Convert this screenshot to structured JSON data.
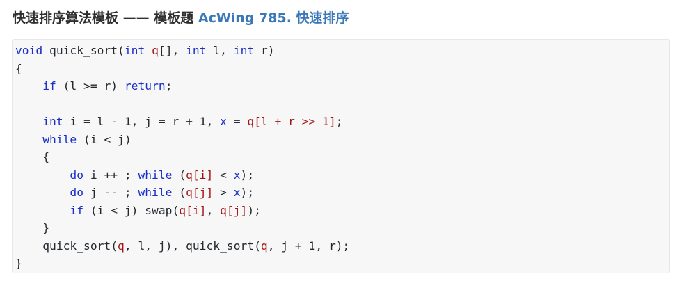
{
  "heading": {
    "title": "快速排序算法模板 —— 模板题 ",
    "link_text": "AcWing 785. 快速排序"
  },
  "code": {
    "language": "cpp",
    "colors": {
      "keyword": "#1a2fc9",
      "variable": "#a31515",
      "plain": "#24292e",
      "background": "#f7f7f7",
      "link": "#3a78b7"
    },
    "lines": [
      [
        [
          "kw",
          "void"
        ],
        [
          "p",
          " quick_sort("
        ],
        [
          "kw",
          "int"
        ],
        [
          "p",
          " "
        ],
        [
          "var",
          "q"
        ],
        [
          "p",
          "[], "
        ],
        [
          "kw",
          "int"
        ],
        [
          "p",
          " l, "
        ],
        [
          "kw",
          "int"
        ],
        [
          "p",
          " r)"
        ]
      ],
      [
        [
          "p",
          "{"
        ]
      ],
      [
        [
          "p",
          "    "
        ],
        [
          "kw",
          "if"
        ],
        [
          "p",
          " (l >= r) "
        ],
        [
          "kw",
          "return"
        ],
        [
          "p",
          ";"
        ]
      ],
      [
        [
          "p",
          ""
        ]
      ],
      [
        [
          "p",
          "    "
        ],
        [
          "kw",
          "int"
        ],
        [
          "p",
          " i = l - 1, j = r + 1, "
        ],
        [
          "kw",
          "x"
        ],
        [
          "p",
          " = "
        ],
        [
          "var",
          "q[l + r >> 1]"
        ],
        [
          "p",
          ";"
        ]
      ],
      [
        [
          "p",
          "    "
        ],
        [
          "kw",
          "while"
        ],
        [
          "p",
          " (i < j)"
        ]
      ],
      [
        [
          "p",
          "    {"
        ]
      ],
      [
        [
          "p",
          "        "
        ],
        [
          "kw",
          "do"
        ],
        [
          "p",
          " i ++ ; "
        ],
        [
          "kw",
          "while"
        ],
        [
          "p",
          " ("
        ],
        [
          "var",
          "q[i]"
        ],
        [
          "p",
          " < "
        ],
        [
          "kw",
          "x"
        ],
        [
          "p",
          ");"
        ]
      ],
      [
        [
          "p",
          "        "
        ],
        [
          "kw",
          "do"
        ],
        [
          "p",
          " j -- ; "
        ],
        [
          "kw",
          "while"
        ],
        [
          "p",
          " ("
        ],
        [
          "var",
          "q[j]"
        ],
        [
          "p",
          " > "
        ],
        [
          "kw",
          "x"
        ],
        [
          "p",
          ");"
        ]
      ],
      [
        [
          "p",
          "        "
        ],
        [
          "kw",
          "if"
        ],
        [
          "p",
          " (i < j) swap("
        ],
        [
          "var",
          "q[i]"
        ],
        [
          "p",
          ", "
        ],
        [
          "var",
          "q[j]"
        ],
        [
          "p",
          ");"
        ]
      ],
      [
        [
          "p",
          "    }"
        ]
      ],
      [
        [
          "p",
          "    quick_sort("
        ],
        [
          "var",
          "q"
        ],
        [
          "p",
          ", l, j), quick_sort("
        ],
        [
          "var",
          "q"
        ],
        [
          "p",
          ", j + 1, r);"
        ]
      ],
      [
        [
          "p",
          "}"
        ]
      ]
    ]
  }
}
